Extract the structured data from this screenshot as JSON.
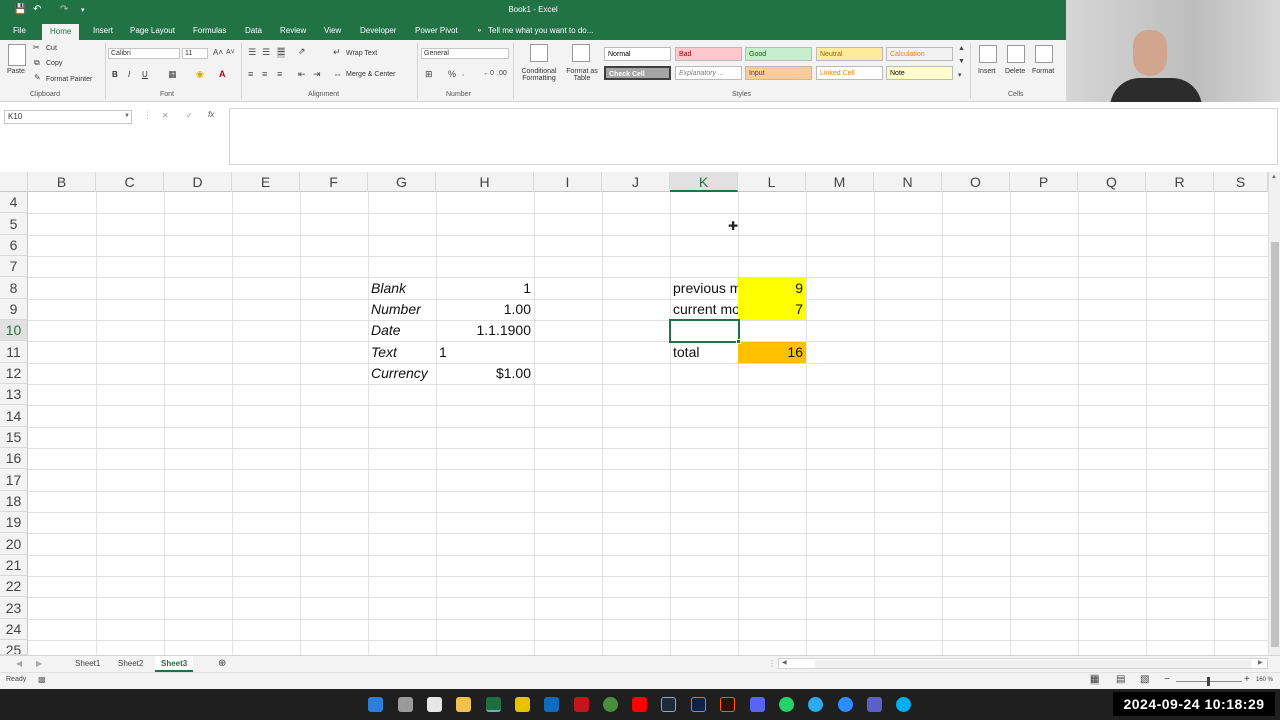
{
  "window": {
    "title": "Book1 - Excel"
  },
  "tabs": [
    "File",
    "Home",
    "Insert",
    "Page Layout",
    "Formulas",
    "Data",
    "Review",
    "View",
    "Developer",
    "Power Pivot"
  ],
  "tell_me": "Tell me what you want to do...",
  "ribbon": {
    "clipboard": {
      "paste": "Paste",
      "cut": "Cut",
      "copy": "Copy",
      "format_painter": "Format Painter",
      "label": "Clipboard"
    },
    "font": {
      "name": "Calibri",
      "size": "11",
      "bold": "B",
      "italic": "I",
      "underline": "U",
      "label": "Font"
    },
    "alignment": {
      "wrap": "Wrap Text",
      "merge": "Merge & Center",
      "label": "Alignment"
    },
    "number": {
      "format": "General",
      "label": "Number"
    },
    "styles": {
      "conditional": "Conditional Formatting",
      "format_table": "Format as Table",
      "label": "Styles",
      "items": [
        {
          "label": "Normal",
          "bg": "#ffffff",
          "fg": "#000000"
        },
        {
          "label": "Bad",
          "bg": "#ffc7ce",
          "fg": "#9c0006"
        },
        {
          "label": "Good",
          "bg": "#c6efce",
          "fg": "#006100"
        },
        {
          "label": "Neutral",
          "bg": "#ffeb9c",
          "fg": "#9c6500"
        },
        {
          "label": "Calculation",
          "bg": "#f2f2f2",
          "fg": "#fa7d00"
        },
        {
          "label": "Check Cell",
          "bg": "#a5a5a5",
          "fg": "#ffffff"
        },
        {
          "label": "Explanatory ...",
          "bg": "#ffffff",
          "fg": "#7f7f7f"
        },
        {
          "label": "Input",
          "bg": "#ffcc99",
          "fg": "#3f3f76"
        },
        {
          "label": "Linked Cell",
          "bg": "#ffffff",
          "fg": "#fa7d00"
        },
        {
          "label": "Note",
          "bg": "#ffffcc",
          "fg": "#000000"
        }
      ]
    },
    "cells": {
      "insert": "Insert",
      "delete": "Delete",
      "format": "Format",
      "label": "Cells"
    }
  },
  "formula_bar": {
    "name_box": "K10",
    "cancel": "✕",
    "enter": "✓",
    "fx": "fx"
  },
  "columns": [
    "B",
    "C",
    "D",
    "E",
    "F",
    "G",
    "H",
    "I",
    "J",
    "K",
    "L",
    "M",
    "N",
    "O",
    "P",
    "Q",
    "R",
    "S"
  ],
  "selected_column": "K",
  "rows": [
    "4",
    "5",
    "6",
    "7",
    "8",
    "9",
    "10",
    "11",
    "12",
    "13",
    "14",
    "15",
    "16",
    "17",
    "18",
    "19",
    "20",
    "21",
    "22",
    "23",
    "24",
    "25"
  ],
  "selected_row": "10",
  "cells": {
    "g8": "Blank",
    "h8": "1",
    "g9": "Number",
    "h9": "1.00",
    "g10": "Date",
    "h10": "1.1.1900",
    "g11": "Text",
    "h11": "1",
    "g12": "Currency",
    "h12": "$1.00",
    "k8": "previous m",
    "l8": "9",
    "k9": "current mo",
    "l9": "7",
    "k11": "total",
    "l11": "16"
  },
  "fill_colors": {
    "yellow": "#ffff00",
    "orange": "#ffc000"
  },
  "sheets": [
    "Sheet1",
    "Sheet2",
    "Sheet3"
  ],
  "active_sheet": "Sheet3",
  "status": {
    "ready": "Ready",
    "zoom": "160 %"
  },
  "clock": "2024-09-24  10:18:29"
}
